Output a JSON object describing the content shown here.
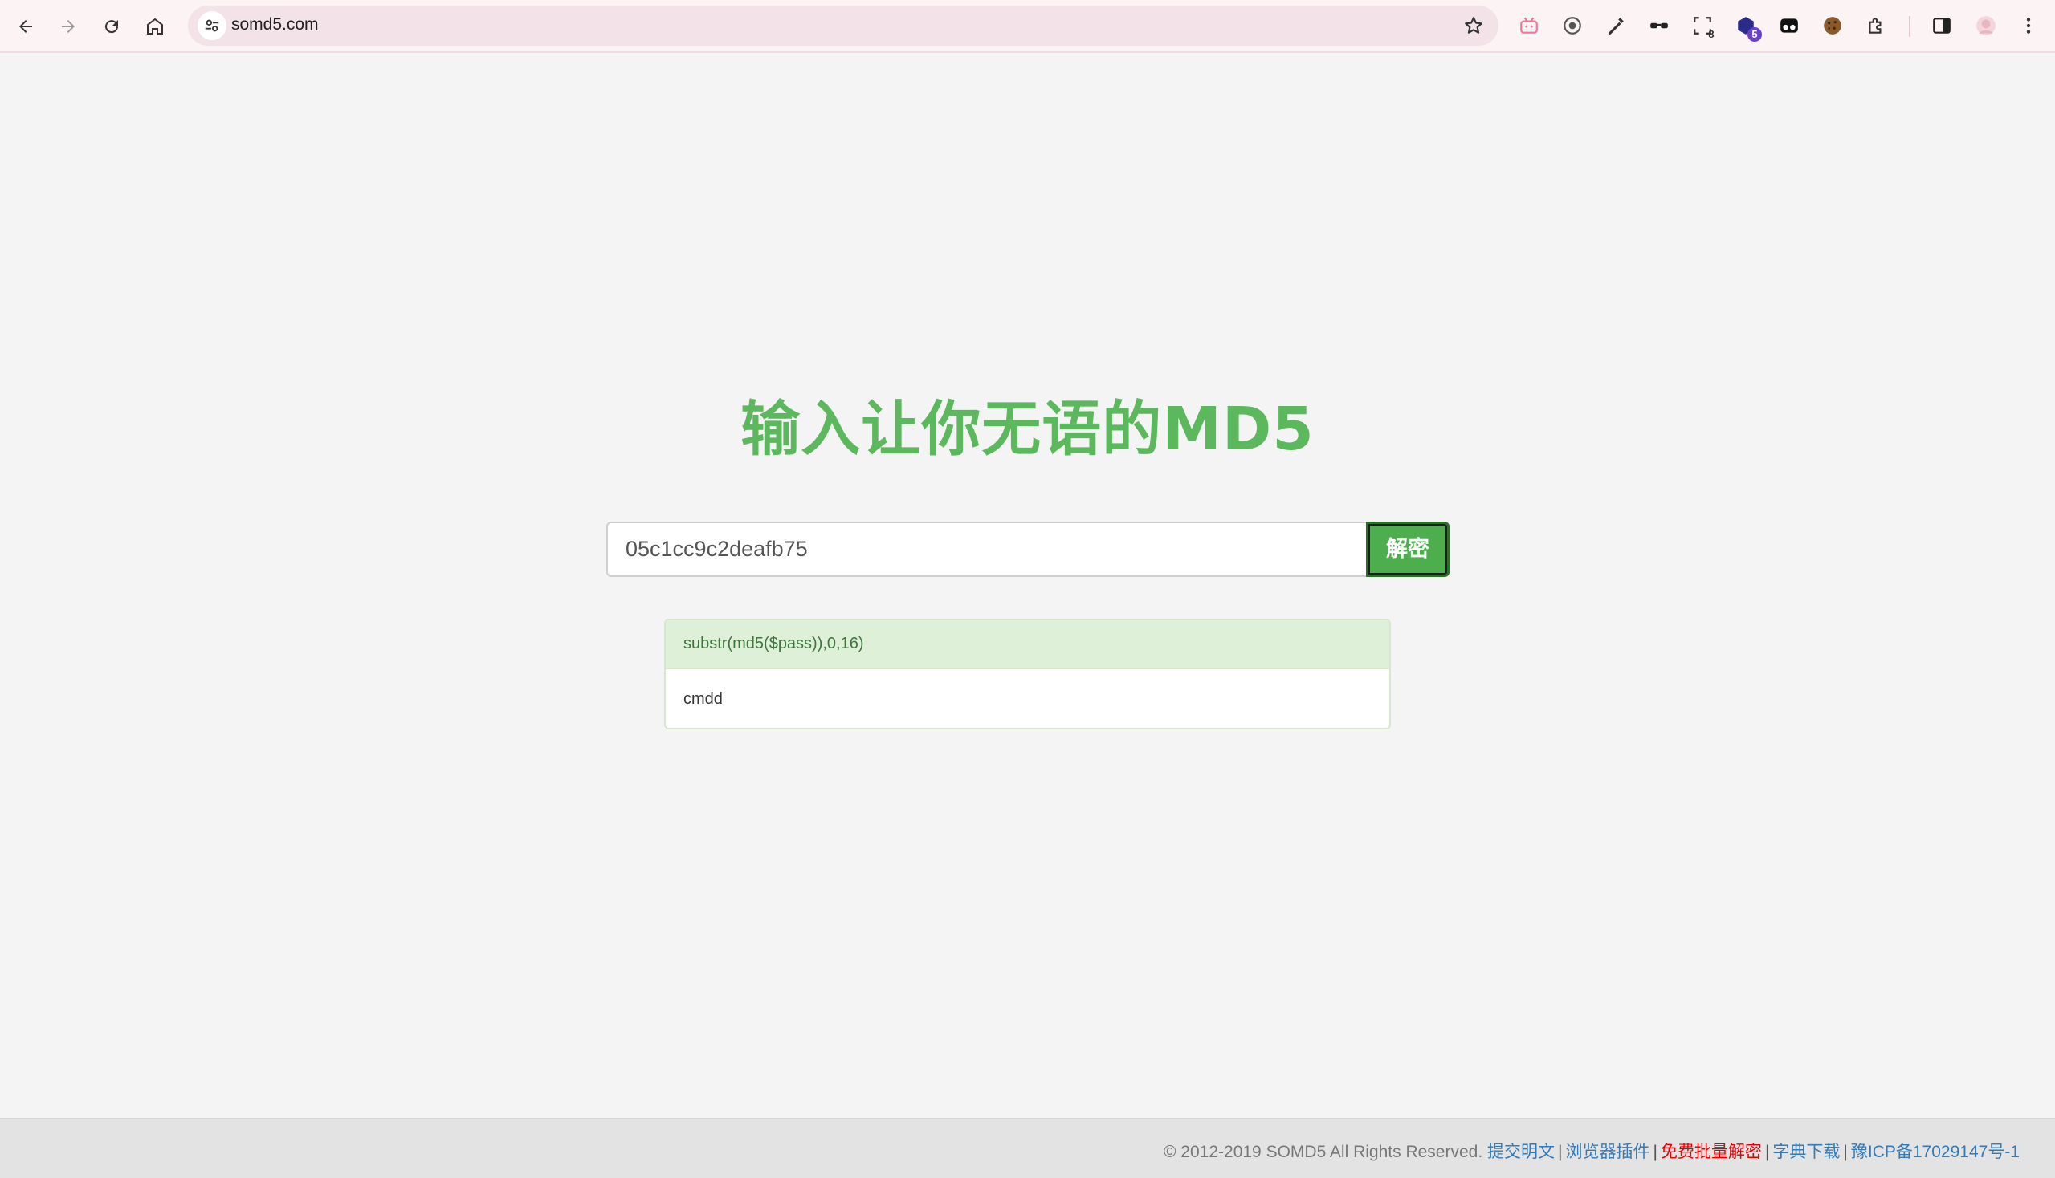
{
  "browser": {
    "url": "somd5.com",
    "extensions": [
      {
        "name": "bilibili-icon",
        "color": "#f0739c"
      },
      {
        "name": "shield-icon",
        "color": "#555555"
      },
      {
        "name": "pen-icon",
        "color": "#333333"
      },
      {
        "name": "glasses-icon",
        "color": "#222222"
      },
      {
        "name": "scan-icon",
        "color": "#333333",
        "badge": "8"
      },
      {
        "name": "cube-icon",
        "color": "#2b2b8a",
        "badge": "5"
      },
      {
        "name": "tampermonkey-icon",
        "color": "#111111"
      },
      {
        "name": "cookie-icon",
        "color": "#8b5a2b"
      },
      {
        "name": "puzzle-icon",
        "color": "#333333"
      }
    ]
  },
  "page": {
    "headline": "输入让你无语的MD5",
    "search": {
      "value": "05c1cc9c2deafb75",
      "button_label": "解密"
    },
    "result": {
      "heading": "substr(md5($pass)),0,16)",
      "value": "cmdd"
    }
  },
  "footer": {
    "copyright": "© 2012-2019 SOMD5 All Rights Reserved. ",
    "links": [
      "提交明文",
      "浏览器插件",
      "免费批量解密",
      "字典下载",
      "豫ICP备17029147号-1"
    ],
    "separator": "|"
  },
  "colors": {
    "accent_green": "#5cb85c",
    "button_green": "#4cae4c",
    "link_blue": "#337ab7",
    "link_red": "#e60000"
  }
}
